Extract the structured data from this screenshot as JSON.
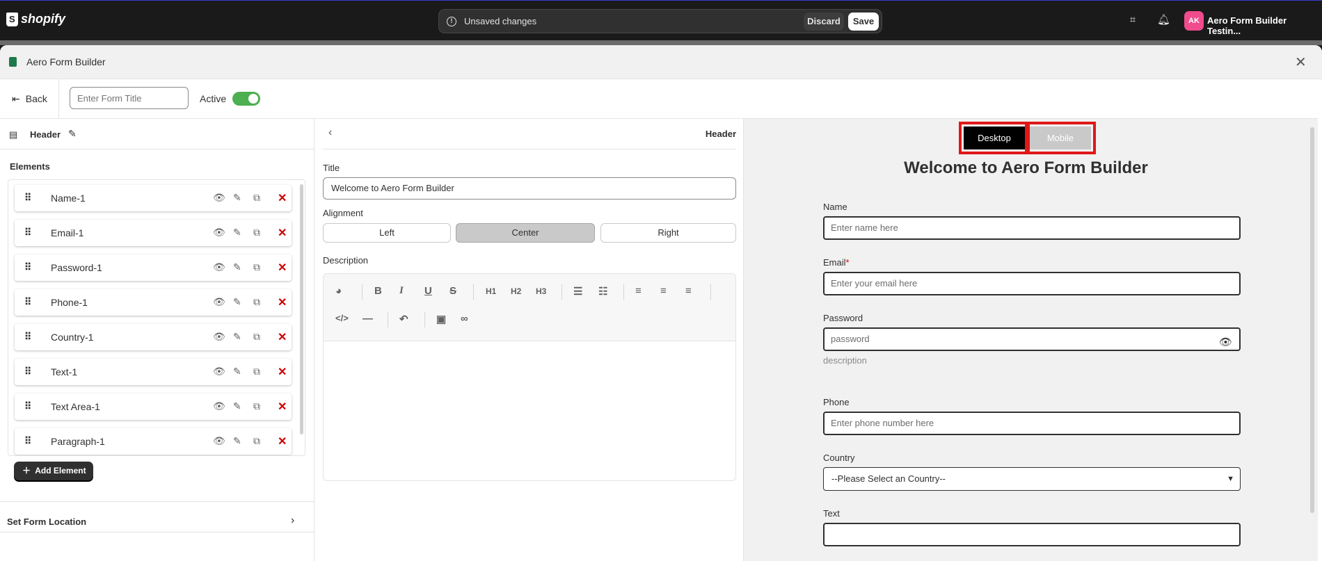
{
  "shopify": {
    "logo_text": "shopify"
  },
  "topbar": {
    "unsaved_message": "Unsaved changes",
    "discard_label": "Discard",
    "save_label": "Save",
    "avatar_initials": "AK",
    "store_name": "Aero Form Builder Testin..."
  },
  "modal": {
    "app_title": "Aero Form Builder"
  },
  "toolbar": {
    "back_label": "Back",
    "form_title_placeholder": "Enter Form Title",
    "active_label": "Active",
    "active_on": true
  },
  "left": {
    "header_label": "Header",
    "elements_title": "Elements",
    "elements": [
      {
        "name": "Name-1"
      },
      {
        "name": "Email-1"
      },
      {
        "name": "Password-1"
      },
      {
        "name": "Phone-1"
      },
      {
        "name": "Country-1"
      },
      {
        "name": "Text-1"
      },
      {
        "name": "Text Area-1"
      },
      {
        "name": "Paragraph-1"
      }
    ],
    "add_element_label": "Add Element",
    "form_location_label": "Set Form Location"
  },
  "middle": {
    "header_label": "Header",
    "title_label": "Title",
    "title_value": "Welcome to Aero Form Builder",
    "alignment_label": "Alignment",
    "alignment_options": [
      "Left",
      "Center",
      "Right"
    ],
    "alignment_selected": "Center",
    "description_label": "Description",
    "toolbar_row1": [
      "H1",
      "H2",
      "H3"
    ]
  },
  "preview": {
    "desktop_label": "Desktop",
    "mobile_label": "Mobile",
    "title": "Welcome to Aero Form Builder",
    "fields": {
      "name_label": "Name",
      "name_placeholder": "Enter name here",
      "email_label": "Email",
      "email_required": "*",
      "email_placeholder": "Enter your email here",
      "password_label": "Password",
      "password_placeholder": "password",
      "password_description": "description",
      "phone_label": "Phone",
      "phone_placeholder": "Enter phone number here",
      "country_label": "Country",
      "country_selected": "--Please Select an Country--",
      "text_label": "Text"
    }
  },
  "colors": {
    "topbar_bg": "#1a1a1a",
    "toggle_on": "#4caf50",
    "delete_icon": "#cc0000",
    "highlight_box": "#e01818",
    "avatar_bg": "#f04b8d"
  }
}
